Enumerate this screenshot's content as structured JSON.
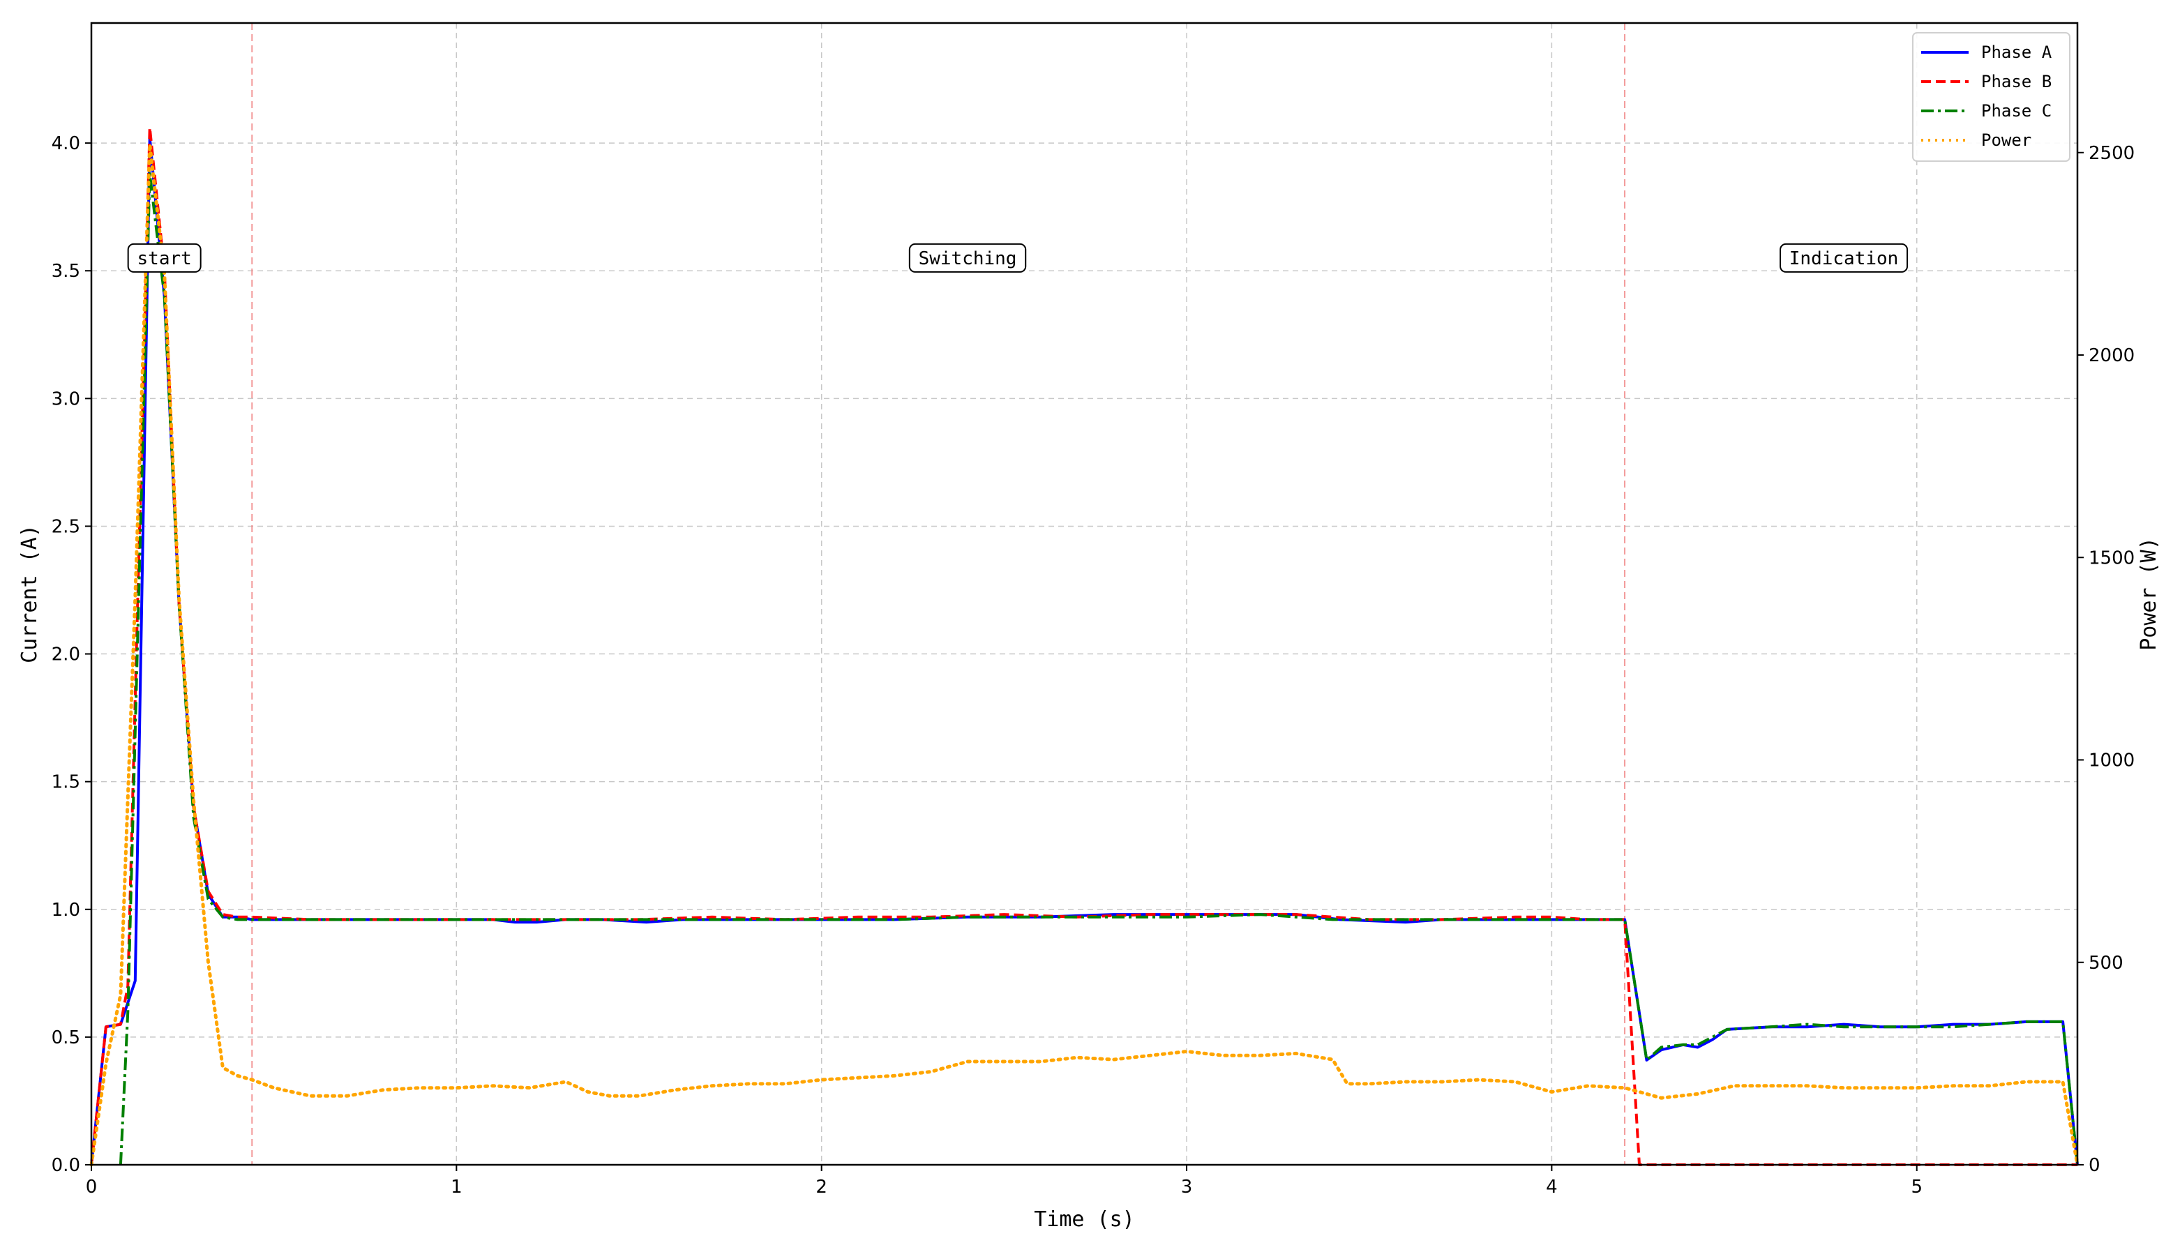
{
  "chart_data": {
    "type": "line",
    "xlabel": "Time (s)",
    "ylabel_left": "Current (A)",
    "ylabel_right": "Power (W)",
    "xlim": [
      0,
      5.44
    ],
    "ylim_left": [
      0,
      4.47
    ],
    "ylim_right": [
      0,
      2820
    ],
    "x_ticks": [
      0,
      1,
      2,
      3,
      4,
      5
    ],
    "y_left_ticks": [
      0.0,
      0.5,
      1.0,
      1.5,
      2.0,
      2.5,
      3.0,
      3.5,
      4.0
    ],
    "y_left_tick_labels": [
      "0.0",
      "0.5",
      "1.0",
      "1.5",
      "2.0",
      "2.5",
      "3.0",
      "3.5",
      "4.0"
    ],
    "y_right_ticks": [
      0,
      500,
      1000,
      1500,
      2000,
      2500
    ],
    "grid": true,
    "legend_position": "top-right",
    "vlines": [
      0.44,
      4.2
    ],
    "phase_labels": [
      {
        "text": "start",
        "x": 0.2,
        "y": 3.55
      },
      {
        "text": "Switching",
        "x": 2.4,
        "y": 3.55
      },
      {
        "text": "Indication",
        "x": 4.8,
        "y": 3.55
      }
    ],
    "series": [
      {
        "name": "Phase A",
        "axis": "left",
        "color": "#0000ff",
        "dash": "solid",
        "points": [
          [
            0,
            0
          ],
          [
            0.04,
            0.54
          ],
          [
            0.08,
            0.55
          ],
          [
            0.12,
            0.72
          ],
          [
            0.16,
            4.02
          ],
          [
            0.2,
            3.4
          ],
          [
            0.24,
            2.2
          ],
          [
            0.28,
            1.4
          ],
          [
            0.32,
            1.06
          ],
          [
            0.36,
            0.97
          ],
          [
            0.4,
            0.97
          ],
          [
            0.44,
            0.96
          ],
          [
            0.6,
            0.96
          ],
          [
            0.8,
            0.96
          ],
          [
            1.0,
            0.96
          ],
          [
            1.1,
            0.96
          ],
          [
            1.16,
            0.95
          ],
          [
            1.22,
            0.95
          ],
          [
            1.3,
            0.96
          ],
          [
            1.4,
            0.96
          ],
          [
            1.52,
            0.95
          ],
          [
            1.62,
            0.96
          ],
          [
            1.8,
            0.96
          ],
          [
            2.0,
            0.96
          ],
          [
            2.2,
            0.96
          ],
          [
            2.4,
            0.97
          ],
          [
            2.6,
            0.97
          ],
          [
            2.8,
            0.98
          ],
          [
            3.0,
            0.98
          ],
          [
            3.2,
            0.98
          ],
          [
            3.3,
            0.98
          ],
          [
            3.42,
            0.96
          ],
          [
            3.6,
            0.95
          ],
          [
            3.7,
            0.96
          ],
          [
            3.9,
            0.96
          ],
          [
            4.0,
            0.96
          ],
          [
            4.2,
            0.96
          ],
          [
            4.26,
            0.41
          ],
          [
            4.3,
            0.45
          ],
          [
            4.36,
            0.47
          ],
          [
            4.4,
            0.46
          ],
          [
            4.44,
            0.49
          ],
          [
            4.48,
            0.53
          ],
          [
            4.6,
            0.54
          ],
          [
            4.7,
            0.54
          ],
          [
            4.8,
            0.55
          ],
          [
            4.9,
            0.54
          ],
          [
            5.0,
            0.54
          ],
          [
            5.1,
            0.55
          ],
          [
            5.2,
            0.55
          ],
          [
            5.3,
            0.56
          ],
          [
            5.4,
            0.56
          ],
          [
            5.44,
            0.0
          ]
        ]
      },
      {
        "name": "Phase B",
        "axis": "left",
        "color": "#ff0000",
        "dash": "14,7",
        "points": [
          [
            0,
            0
          ],
          [
            0.04,
            0.54
          ],
          [
            0.08,
            0.55
          ],
          [
            0.1,
            0.7
          ],
          [
            0.16,
            4.06
          ],
          [
            0.2,
            3.5
          ],
          [
            0.24,
            2.2
          ],
          [
            0.28,
            1.4
          ],
          [
            0.32,
            1.07
          ],
          [
            0.36,
            0.98
          ],
          [
            0.4,
            0.97
          ],
          [
            0.44,
            0.97
          ],
          [
            0.6,
            0.96
          ],
          [
            0.8,
            0.96
          ],
          [
            1.0,
            0.96
          ],
          [
            1.16,
            0.96
          ],
          [
            1.3,
            0.96
          ],
          [
            1.5,
            0.96
          ],
          [
            1.7,
            0.97
          ],
          [
            1.9,
            0.96
          ],
          [
            2.1,
            0.97
          ],
          [
            2.3,
            0.97
          ],
          [
            2.5,
            0.98
          ],
          [
            2.7,
            0.97
          ],
          [
            2.9,
            0.98
          ],
          [
            3.1,
            0.98
          ],
          [
            3.3,
            0.98
          ],
          [
            3.5,
            0.96
          ],
          [
            3.7,
            0.96
          ],
          [
            3.9,
            0.97
          ],
          [
            4.0,
            0.97
          ],
          [
            4.1,
            0.96
          ],
          [
            4.2,
            0.96
          ],
          [
            4.24,
            0.0
          ],
          [
            5.44,
            0.0
          ]
        ]
      },
      {
        "name": "Phase C",
        "axis": "left",
        "color": "#008000",
        "dash": "18,6,4,6",
        "points": [
          [
            0.08,
            0.0
          ],
          [
            0.1,
            0.6
          ],
          [
            0.16,
            3.88
          ],
          [
            0.2,
            3.4
          ],
          [
            0.24,
            2.2
          ],
          [
            0.28,
            1.36
          ],
          [
            0.32,
            1.04
          ],
          [
            0.36,
            0.97
          ],
          [
            0.4,
            0.96
          ],
          [
            0.44,
            0.96
          ],
          [
            0.6,
            0.96
          ],
          [
            0.8,
            0.96
          ],
          [
            1.0,
            0.96
          ],
          [
            1.2,
            0.96
          ],
          [
            1.4,
            0.96
          ],
          [
            1.6,
            0.96
          ],
          [
            1.8,
            0.96
          ],
          [
            2.0,
            0.96
          ],
          [
            2.2,
            0.96
          ],
          [
            2.4,
            0.97
          ],
          [
            2.6,
            0.97
          ],
          [
            2.8,
            0.97
          ],
          [
            3.0,
            0.97
          ],
          [
            3.2,
            0.98
          ],
          [
            3.4,
            0.96
          ],
          [
            3.6,
            0.96
          ],
          [
            3.8,
            0.96
          ],
          [
            4.0,
            0.96
          ],
          [
            4.2,
            0.96
          ],
          [
            4.26,
            0.41
          ],
          [
            4.3,
            0.46
          ],
          [
            4.36,
            0.47
          ],
          [
            4.4,
            0.47
          ],
          [
            4.44,
            0.5
          ],
          [
            4.48,
            0.53
          ],
          [
            4.6,
            0.54
          ],
          [
            4.7,
            0.55
          ],
          [
            4.8,
            0.54
          ],
          [
            4.9,
            0.54
          ],
          [
            5.0,
            0.54
          ],
          [
            5.1,
            0.54
          ],
          [
            5.2,
            0.55
          ],
          [
            5.3,
            0.56
          ],
          [
            5.4,
            0.56
          ],
          [
            5.44,
            0.0
          ]
        ]
      },
      {
        "name": "Power",
        "axis": "right",
        "color": "#ffa500",
        "dash": "3,7",
        "points": [
          [
            0,
            0
          ],
          [
            0.04,
            250
          ],
          [
            0.08,
            420
          ],
          [
            0.12,
            1400
          ],
          [
            0.16,
            2520
          ],
          [
            0.2,
            2200
          ],
          [
            0.24,
            1400
          ],
          [
            0.28,
            900
          ],
          [
            0.32,
            500
          ],
          [
            0.36,
            240
          ],
          [
            0.4,
            220
          ],
          [
            0.44,
            210
          ],
          [
            0.5,
            190
          ],
          [
            0.6,
            170
          ],
          [
            0.7,
            170
          ],
          [
            0.8,
            185
          ],
          [
            0.9,
            190
          ],
          [
            1.0,
            190
          ],
          [
            1.1,
            195
          ],
          [
            1.2,
            190
          ],
          [
            1.3,
            205
          ],
          [
            1.36,
            180
          ],
          [
            1.42,
            170
          ],
          [
            1.5,
            170
          ],
          [
            1.6,
            185
          ],
          [
            1.7,
            195
          ],
          [
            1.8,
            200
          ],
          [
            1.9,
            200
          ],
          [
            2.0,
            210
          ],
          [
            2.1,
            215
          ],
          [
            2.2,
            220
          ],
          [
            2.3,
            230
          ],
          [
            2.4,
            255
          ],
          [
            2.5,
            255
          ],
          [
            2.6,
            255
          ],
          [
            2.7,
            265
          ],
          [
            2.8,
            260
          ],
          [
            2.9,
            270
          ],
          [
            3.0,
            280
          ],
          [
            3.1,
            270
          ],
          [
            3.2,
            270
          ],
          [
            3.3,
            275
          ],
          [
            3.4,
            260
          ],
          [
            3.44,
            200
          ],
          [
            3.5,
            200
          ],
          [
            3.6,
            205
          ],
          [
            3.7,
            205
          ],
          [
            3.8,
            210
          ],
          [
            3.9,
            205
          ],
          [
            4.0,
            180
          ],
          [
            4.1,
            195
          ],
          [
            4.2,
            190
          ],
          [
            4.3,
            165
          ],
          [
            4.4,
            175
          ],
          [
            4.5,
            195
          ],
          [
            4.6,
            195
          ],
          [
            4.7,
            195
          ],
          [
            4.8,
            190
          ],
          [
            4.9,
            190
          ],
          [
            5.0,
            190
          ],
          [
            5.1,
            195
          ],
          [
            5.2,
            195
          ],
          [
            5.3,
            205
          ],
          [
            5.4,
            205
          ],
          [
            5.44,
            0
          ]
        ]
      }
    ]
  }
}
